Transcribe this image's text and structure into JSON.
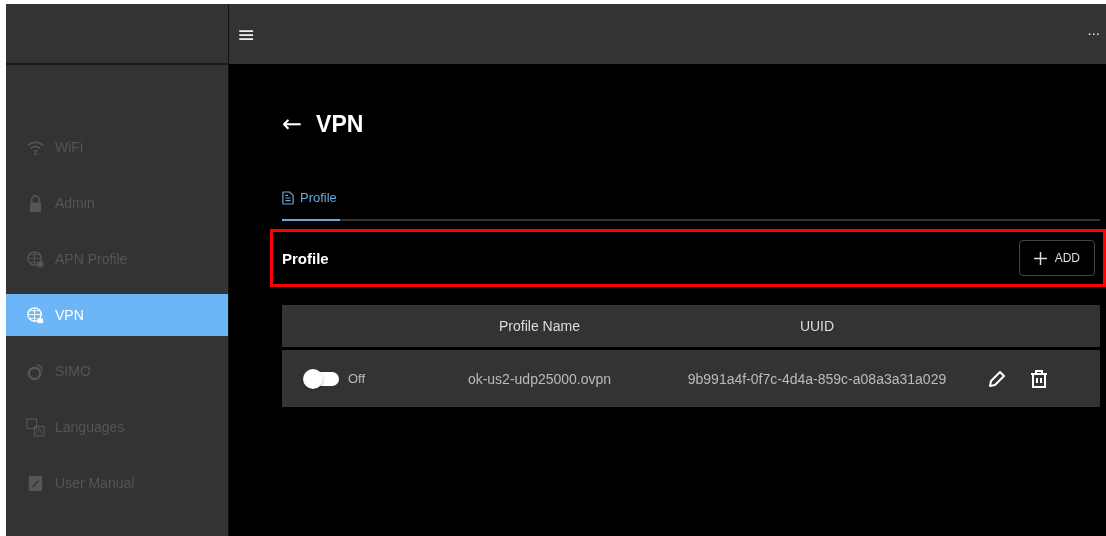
{
  "sidebar": {
    "items": [
      {
        "kind": "wifi",
        "label": "WiFi",
        "selected": false
      },
      {
        "kind": "lock",
        "label": "Admin",
        "selected": false
      },
      {
        "kind": "apn",
        "label": "APN Profile",
        "selected": false
      },
      {
        "kind": "vpn",
        "label": "VPN",
        "selected": true
      },
      {
        "kind": "simo",
        "label": "SIMO",
        "selected": false
      },
      {
        "kind": "languages",
        "label": "Languages",
        "selected": false
      },
      {
        "kind": "manual",
        "label": "User Manual",
        "selected": false
      }
    ]
  },
  "topbar": {
    "menu_icon": "≡",
    "more_icon": "···"
  },
  "page": {
    "back_icon": "←",
    "title": "VPN"
  },
  "tabs": [
    {
      "label": "Profile",
      "selected": true
    }
  ],
  "section": {
    "title": "Profile",
    "highlighted": true,
    "add_button": "ADD"
  },
  "table": {
    "columns": [
      "",
      "Profile Name",
      "UUID",
      ""
    ],
    "rows": [
      {
        "on": false,
        "state_label": "Off",
        "profile_name": "ok-us2-udp25000.ovpn",
        "uuid": "9b991a4f-0f7c-4d4a-859c-a08a3a31a029"
      }
    ]
  }
}
